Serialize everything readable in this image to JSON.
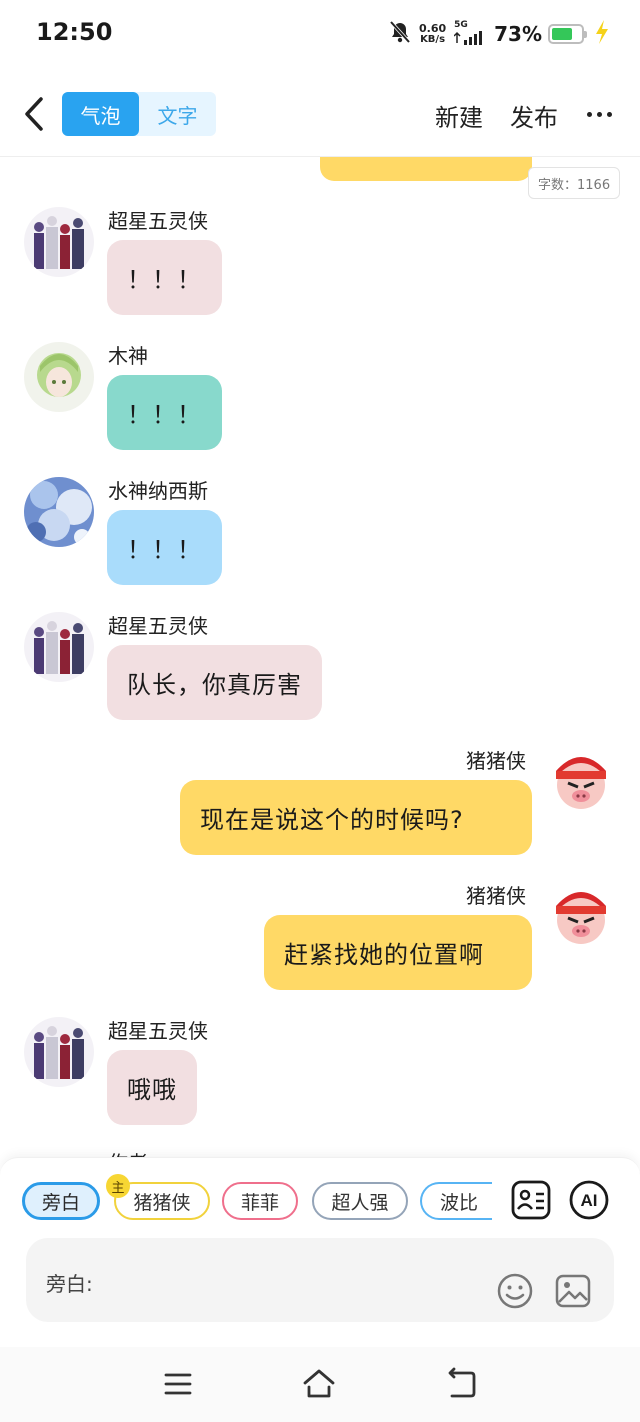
{
  "status_bar": {
    "time": "12:50",
    "net_speed_value": "0.60",
    "net_speed_unit": "KB/s",
    "network_type": "5G",
    "battery_percent": "73%",
    "battery_level": 0.73,
    "icons": [
      "mute-bell-icon",
      "signal-icon",
      "battery-icon",
      "charging-bolt-icon"
    ]
  },
  "header": {
    "mode_tabs": [
      {
        "label": "气泡",
        "active": true
      },
      {
        "label": "文字",
        "active": false
      }
    ],
    "new_label": "新建",
    "publish_label": "发布"
  },
  "chat": {
    "word_count": "字数：1166",
    "messages": [
      {
        "sender": "超星五灵侠",
        "side": "left",
        "text": "！！！",
        "color": "#f2dfe1"
      },
      {
        "sender": "木神",
        "side": "left",
        "text": "！！！",
        "color": "#88d9cc"
      },
      {
        "sender": "水神纳西斯",
        "side": "left",
        "text": "！！！",
        "color": "#a9dcfb"
      },
      {
        "sender": "超星五灵侠",
        "side": "left",
        "text": "队长，你真厉害",
        "color": "#f2dfe1"
      },
      {
        "sender": "猪猪侠",
        "side": "right",
        "text": "现在是说这个的时候吗?",
        "color": "#ffd966"
      },
      {
        "sender": "猪猪侠",
        "side": "right",
        "text": "赶紧找她的位置啊",
        "color": "#ffd966"
      },
      {
        "sender": "超星五灵侠",
        "side": "left",
        "text": "哦哦",
        "color": "#f2dfe1"
      }
    ],
    "partial_sender": "作者"
  },
  "bottom": {
    "role_chips": [
      "旁白",
      "猪猪侠",
      "菲菲",
      "超人强",
      "波比"
    ],
    "main_badge": "主",
    "tool_icons": [
      "role-card-icon",
      "ai-icon"
    ],
    "ai_label": "AI",
    "input_label": "旁白:",
    "input_icons": [
      "emoji-icon",
      "image-icon"
    ]
  },
  "nav_bar": {
    "icons": [
      "menu-icon",
      "home-icon",
      "back-icon"
    ]
  },
  "colors": {
    "accent": "#29a3f0",
    "self_bubble": "#ffd966"
  }
}
